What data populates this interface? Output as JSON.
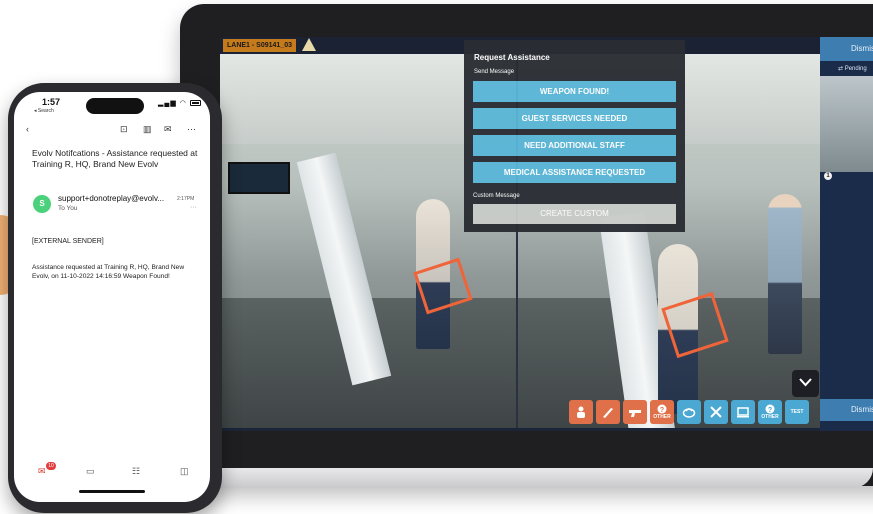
{
  "camera": {
    "lane_label": "LANE1 - S09141_03"
  },
  "assist_panel": {
    "title": "Request Assistance",
    "send_label": "Send Message",
    "buttons": [
      "WEAPON FOUND!",
      "GUEST SERVICES NEEDED",
      "NEED ADDITIONAL STAFF",
      "MEDICAL ASSISTANCE REQUESTED"
    ],
    "custom_label": "Custom Message",
    "custom_button": "CREATE CUSTOM"
  },
  "toolbar": {
    "icons": [
      "person-icon",
      "knife-icon",
      "gun-icon",
      "other-icon",
      "bag-icon",
      "tools-icon",
      "laptop-icon",
      "other-blue-icon",
      "test-icon"
    ],
    "other_label": "OTHER",
    "test_label": "TEST"
  },
  "side_panel": {
    "top_label": "Dismiss",
    "pending_label": "Pending",
    "badge_number": "1",
    "bottom_label": "Dismiss"
  },
  "phone": {
    "time": "1:57",
    "back_label": "◂ Search",
    "subject": "Evolv Notifcations - Assistance requested at Training R, HQ, Brand New Evolv",
    "sender_initial": "S",
    "sender": "support+donotreplay@evolv...",
    "sent_time": "2:17PM",
    "to": "To You",
    "external": "[EXTERNAL SENDER]",
    "body": "Assistance requested at Training R, HQ, Brand New Evolv, on 11-10-2022 14:16:59 Weapon Found!",
    "mail_badge": "10"
  },
  "colors": {
    "accent_blue": "#5ab6d6",
    "alert_orange": "#e0704a",
    "detection_box": "#f0643a",
    "side_blue": "#3d7db0"
  }
}
